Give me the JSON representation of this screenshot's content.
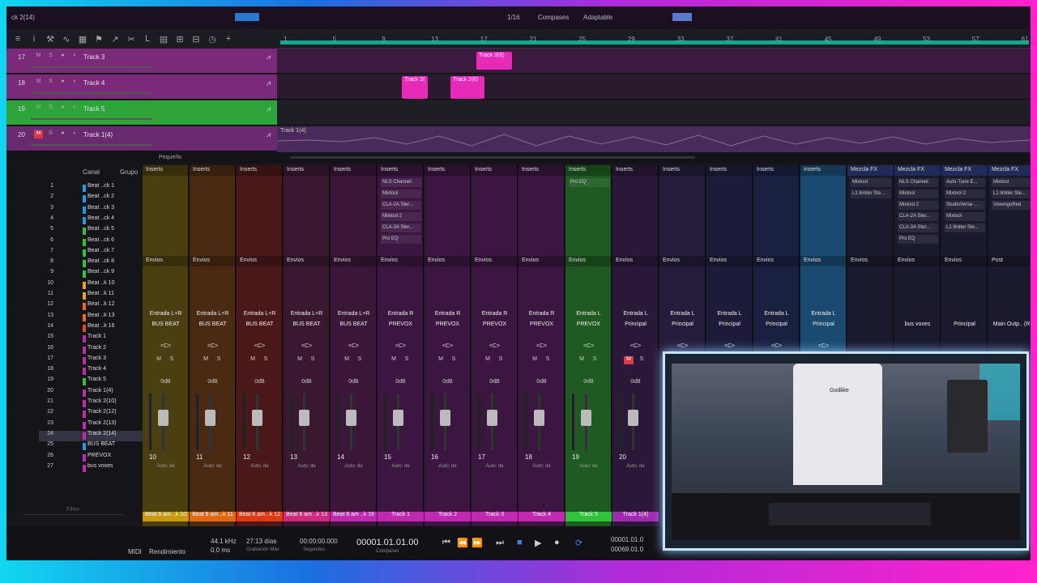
{
  "colors": {
    "accent_green": "#2fc23a",
    "clip_pink": "#e82ab8",
    "frame_cyan": "#12d6f0",
    "frame_magenta": "#ff22cc"
  },
  "titlebar": {
    "song": "ck 2(14)",
    "quantize": "1/16",
    "timebase": "Compases",
    "snap": "Adaptable"
  },
  "toolbar_icons": [
    "list-icon",
    "info-icon",
    "tool-icon",
    "curve-icon",
    "grid-icon",
    "flag-icon",
    "arrow-icon",
    "cut-icon",
    "l-icon",
    "film-icon",
    "split-icon",
    "mixer-icon",
    "clock-icon",
    "plus-icon"
  ],
  "ruler": {
    "ticks": [
      "1",
      "5",
      "9",
      "13",
      "17",
      "21",
      "25",
      "29",
      "33",
      "37",
      "41",
      "45",
      "49",
      "53",
      "57",
      "61"
    ]
  },
  "tracks": [
    {
      "num": "17",
      "name": "Track 3",
      "color": "#7a2a78"
    },
    {
      "num": "18",
      "name": "Track 4",
      "color": "#7a2a78"
    },
    {
      "num": "19",
      "name": "Track 5",
      "color": "#2fa43a"
    },
    {
      "num": "20",
      "name": "Track 1(4)",
      "color": "#6a2a70"
    }
  ],
  "clips": [
    {
      "label": "Track 3(6)",
      "lane": 0
    },
    {
      "label": "Track 2(",
      "lane": 1
    },
    {
      "label": "Track 2(6)",
      "lane": 1
    }
  ],
  "audio_clip": {
    "label": "Track 1(4)"
  },
  "arrange_footer": {
    "zoom_label": "Pequeño"
  },
  "chanlist": {
    "header_canal": "Canal",
    "header_grupo": "Grupo",
    "filter_placeholder": "Filtro",
    "rows": [
      {
        "n": "1",
        "name": "Beat ..ck 1",
        "color": "#1f9be8"
      },
      {
        "n": "2",
        "name": "Beat ..ck 2",
        "color": "#1f9be8"
      },
      {
        "n": "3",
        "name": "Beat ..ck 3",
        "color": "#1f9be8"
      },
      {
        "n": "4",
        "name": "Beat ..ck 4",
        "color": "#1f9be8"
      },
      {
        "n": "5",
        "name": "Beat ..ck 5",
        "color": "#2fc23a"
      },
      {
        "n": "6",
        "name": "Beat ..ck 6",
        "color": "#2fc23a"
      },
      {
        "n": "7",
        "name": "Beat ..ck 7",
        "color": "#2fc23a"
      },
      {
        "n": "8",
        "name": "Beat ..ck 8",
        "color": "#2fc23a"
      },
      {
        "n": "9",
        "name": "Beat ..ck 9",
        "color": "#2fc23a"
      },
      {
        "n": "10",
        "name": "Beat ..k 10",
        "color": "#e8a41f"
      },
      {
        "n": "11",
        "name": "Beat ..k 11",
        "color": "#e8a41f"
      },
      {
        "n": "12",
        "name": "Beat ..k 12",
        "color": "#e86a1f"
      },
      {
        "n": "13",
        "name": "Beat ..k 13",
        "color": "#e86a1f"
      },
      {
        "n": "14",
        "name": "Beat ..k 16",
        "color": "#e84a1f"
      },
      {
        "n": "15",
        "name": "Track 1",
        "color": "#c02ab0"
      },
      {
        "n": "16",
        "name": "Track 2",
        "color": "#c02ab0"
      },
      {
        "n": "17",
        "name": "Track 3",
        "color": "#c02ab0"
      },
      {
        "n": "18",
        "name": "Track 4",
        "color": "#c02ab0"
      },
      {
        "n": "19",
        "name": "Track 5",
        "color": "#2fc23a"
      },
      {
        "n": "20",
        "name": "Track 1(4)",
        "color": "#c02ab0"
      },
      {
        "n": "21",
        "name": "Track 2(10)",
        "color": "#c02ab0"
      },
      {
        "n": "22",
        "name": "Track 2(12)",
        "color": "#c02ab0"
      },
      {
        "n": "23",
        "name": "Track 2(13)",
        "color": "#c02ab0"
      },
      {
        "n": "24",
        "name": "Track 2(14)",
        "color": "#c02ab0"
      },
      {
        "n": "25",
        "name": "BUS BEAT",
        "color": "#1f9be8"
      },
      {
        "n": "26",
        "name": "PREVOX",
        "color": "#c02ab0"
      },
      {
        "n": "27",
        "name": "bus voxes",
        "color": "#c02ab0"
      }
    ]
  },
  "mixer": {
    "inserts_label": "Inserts",
    "sends_label": "Envios",
    "fx_label": "Mezcla FX",
    "post_label": "Post",
    "db_label": "0dB",
    "pan_label": "<C>",
    "auto_label": "Auto: de",
    "mute_label": "M",
    "solo_label": "S",
    "strips": [
      {
        "num": "10",
        "in": "Entrada L+R",
        "out": "BUS BEAT",
        "foot": "Beat 6 am ..k 10",
        "color": "#4a3f10",
        "foot_color": "#c79a10",
        "plugins": []
      },
      {
        "num": "11",
        "in": "Entrada L+R",
        "out": "BUS BEAT",
        "foot": "Beat 6 am ..k 11",
        "color": "#4a2a12",
        "foot_color": "#e06a14",
        "plugins": []
      },
      {
        "num": "12",
        "in": "Entrada L+R",
        "out": "BUS BEAT",
        "foot": "Beat 6 am ..k 12",
        "color": "#4a1818",
        "foot_color": "#e03a14",
        "plugins": []
      },
      {
        "num": "13",
        "in": "Entrada L+R",
        "out": "BUS BEAT",
        "foot": "Beat 6 am ..k 13",
        "color": "#3a1830",
        "foot_color": "#d02a80",
        "plugins": []
      },
      {
        "num": "14",
        "in": "Entrada L+R",
        "out": "BUS BEAT",
        "foot": "Beat 6 am ..k 16",
        "color": "#3a1638",
        "foot_color": "#c02ab0",
        "plugins": []
      },
      {
        "num": "15",
        "in": "Entrada R",
        "out": "PREVOX",
        "foot": "Track 1",
        "color": "#3a1640",
        "foot_color": "#c02ab0",
        "plugins": [
          "NLS Channel",
          "Mixtool",
          "CLA-2A Ster...",
          "Mixtool 2",
          "CLA-3A Ster...",
          "Pro EQ"
        ]
      },
      {
        "num": "16",
        "in": "Entrada R",
        "out": "PREVOX",
        "foot": "Track 2",
        "color": "#3a1640",
        "foot_color": "#c02ab0",
        "plugins": []
      },
      {
        "num": "17",
        "in": "Entrada R",
        "out": "PREVOX",
        "foot": "Track 3",
        "color": "#3a1640",
        "foot_color": "#c02ab0",
        "plugins": []
      },
      {
        "num": "18",
        "in": "Entrada R",
        "out": "PREVOX",
        "foot": "Track 4",
        "color": "#3a1640",
        "foot_color": "#c02ab0",
        "plugins": []
      },
      {
        "num": "19",
        "in": "Entrada L",
        "out": "PREVOX",
        "foot": "Track 5",
        "color": "#1f5a22",
        "foot_color": "#2fc23a",
        "plugins": [
          "Pro EQ"
        ]
      },
      {
        "num": "20",
        "in": "Entrada L",
        "out": "Principal",
        "foot": "Track 1(4)",
        "color": "#2a1838",
        "foot_color": "#a02ab0",
        "plugins": []
      },
      {
        "num": "",
        "in": "Entrada L",
        "out": "Principal",
        "foot": "",
        "color": "#241c3a",
        "foot_color": "#202028",
        "plugins": []
      },
      {
        "num": "",
        "in": "Entrada L",
        "out": "Principal",
        "foot": "",
        "color": "#1c1c3a",
        "foot_color": "#202028",
        "plugins": []
      },
      {
        "num": "",
        "in": "Entrada L",
        "out": "Principal",
        "foot": "",
        "color": "#1a2040",
        "foot_color": "#202028",
        "plugins": []
      },
      {
        "num": "",
        "in": "Entrada L",
        "out": "Principal",
        "foot": "",
        "color": "#1a4a70",
        "foot_color": "#202028",
        "plugins": []
      }
    ],
    "fx_strips": [
      {
        "out": "",
        "plugins": [
          "Mixtool",
          "L1 limiter Ste..."
        ]
      },
      {
        "out": "bus voxes",
        "plugins": [
          "NLS Channel",
          "Mixtool",
          "Mixtool 2",
          "CLA-2A Ster...",
          "CLA-3A Ster...",
          "Pro EQ"
        ]
      },
      {
        "out": "Principal",
        "plugins": [
          "Auto-Tune E...",
          "Mixtool 2",
          "StudioVerse ...",
          "Mixtool",
          "L1 limiter Ste..."
        ]
      },
      {
        "out": "Main Outp.. (R",
        "plugins": [
          "Mixtool",
          "L1 limiter Ste...",
          "VoxengoRed"
        ]
      }
    ]
  },
  "transport": {
    "midi": "MIDI",
    "perf": "Rendimiento",
    "sample_rate": "44.1 kHz",
    "latency": "0.0 ms",
    "record_time": "27:13 días",
    "record_label": "Grabación Máx",
    "seconds": "00:00:00.000",
    "seconds_label": "Segundos",
    "position": "00001.01.01.00",
    "position_label": "Compases",
    "loop_l": "00001.01.0",
    "loop_r": "00069.01.0"
  },
  "webcam": {
    "shirt_text": "Godlike"
  }
}
